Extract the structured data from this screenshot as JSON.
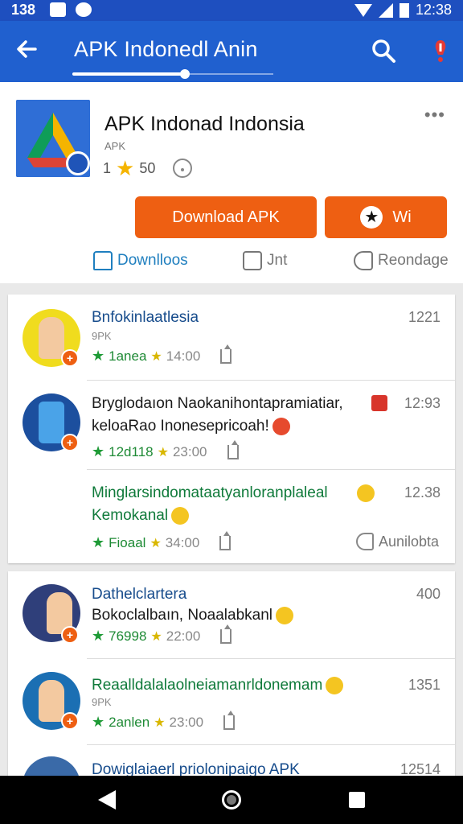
{
  "status_bar": {
    "time_left": "138",
    "time_right": "12:38"
  },
  "app_bar": {
    "title": "APK Indonedl Anin"
  },
  "app": {
    "name": "APK Indonad Indonsia",
    "subtitle": "APK",
    "rating_left": "1",
    "rating_count": "50"
  },
  "buttons": {
    "download": "Download APK",
    "wishlist": "Wi"
  },
  "actions": {
    "download": "Downlloos",
    "like": "Jnt",
    "share": "Reondage"
  },
  "feed": {
    "items": [
      {
        "title": "Bnfokinlaatlesia",
        "subtitle": "9PK",
        "time": "1221",
        "meta_label": "1anea",
        "meta_time": "14:00",
        "title_color": "blue"
      },
      {
        "title": "Bryglodaıon Naokanihontapramiatiar,",
        "title2": "keloaRao Inonesepricoah!",
        "time": "12:93",
        "meta_label": "12d118",
        "meta_time": "23:00",
        "title_color": "default"
      },
      {
        "title": "Minglarsindomataatyanloranplaleal",
        "title2": "Kemokanal",
        "time": "12.38",
        "meta_label": "Fioaal",
        "meta_time": "34:00",
        "action": "Aunilobta",
        "title_color": "green"
      },
      {
        "title": "Dathelclartera",
        "title2": "Bokoclalbaın, Noaalabkanl",
        "time": "400",
        "meta_label": "76998",
        "meta_time": "22:00",
        "title_color": "blue"
      },
      {
        "title": "Reaalldalalaolneiamanrldonemam",
        "subtitle": "9PK",
        "time": "1351",
        "meta_label": "2anlen",
        "meta_time": "23:00",
        "title_color": "green"
      },
      {
        "title": "Dowiglaiaerl priolonipaigo APK",
        "time": "12514",
        "title_color": "blue"
      }
    ]
  },
  "colors": {
    "app_bar": "#2060cf",
    "status_bar": "#1e4fbf",
    "accent_orange": "#ee5f12",
    "green": "#1e9a36",
    "star": "#f5b400"
  },
  "icons": [
    "back-arrow-icon",
    "search-icon",
    "alert-icon",
    "star-icon",
    "face-icon",
    "more-icon",
    "download-icon",
    "like-icon",
    "share-icon",
    "nav-back-icon",
    "nav-home-icon",
    "nav-recent-icon"
  ]
}
